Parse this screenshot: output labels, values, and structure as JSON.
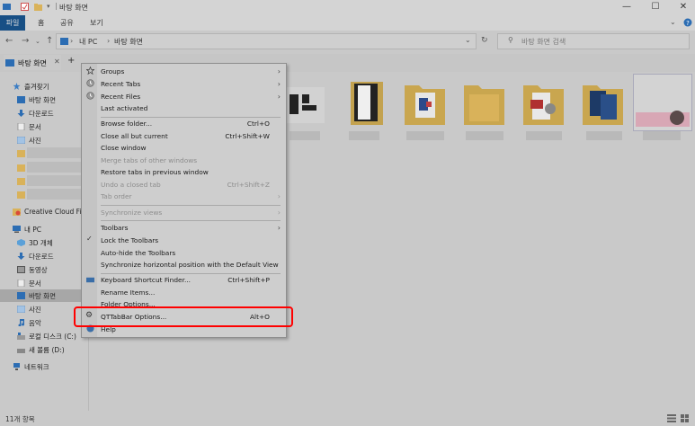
{
  "window": {
    "title": "바탕 화면",
    "controls": [
      "—",
      "☐",
      "✕"
    ]
  },
  "ribbon": {
    "tabs": [
      "파일",
      "홈",
      "공유",
      "보기"
    ]
  },
  "address": {
    "path": [
      "내 PC",
      "바탕 화면"
    ],
    "search_placeholder": "바탕 화면 검색"
  },
  "tabs": {
    "items": [
      {
        "label": "바탕 화면"
      }
    ],
    "add": "+"
  },
  "nav": {
    "quick_access": "즐겨찾기",
    "quick_items": [
      "바탕 화면",
      "다운로드",
      "문서",
      "사진"
    ],
    "creative_cloud": "Creative Cloud File",
    "this_pc": "내 PC",
    "pc_items": [
      "3D 개체",
      "다운로드",
      "동영상",
      "문서",
      "바탕 화면",
      "사진",
      "음악",
      "로컬 디스크 (C:)",
      "새 볼륨 (D:)"
    ],
    "network": "네트워크"
  },
  "status": {
    "count": "11개 항목"
  },
  "menu": {
    "items": [
      {
        "label": "Groups",
        "submenu": true,
        "icon": "star-icon"
      },
      {
        "label": "Recent Tabs",
        "submenu": true,
        "icon": "recent-tabs-icon"
      },
      {
        "label": "Recent Files",
        "submenu": true,
        "icon": "recent-files-icon"
      },
      {
        "label": "Last activated"
      },
      {
        "separator": true
      },
      {
        "label": "Browse folder...",
        "shortcut": "Ctrl+O"
      },
      {
        "label": "Close all but current",
        "shortcut": "Ctrl+Shift+W"
      },
      {
        "label": "Close window"
      },
      {
        "label": "Merge tabs of other windows",
        "disabled": true
      },
      {
        "label": "Restore tabs in previous window"
      },
      {
        "label": "Undo a closed tab",
        "shortcut": "Ctrl+Shift+Z",
        "disabled": true
      },
      {
        "label": "Tab order",
        "submenu": true,
        "disabled": true
      },
      {
        "separator": true
      },
      {
        "label": "Synchronize views",
        "submenu": true,
        "disabled": true
      },
      {
        "separator": true
      },
      {
        "label": "Toolbars",
        "submenu": true
      },
      {
        "label": "Lock the Toolbars",
        "checked": true
      },
      {
        "label": "Auto-hide the Toolbars"
      },
      {
        "label": "Synchronize horizontal position with the Default View"
      },
      {
        "separator": true
      },
      {
        "label": "Keyboard Shortcut Finder...",
        "shortcut": "Ctrl+Shift+P",
        "icon": "keyboard-icon"
      },
      {
        "label": "Rename Items..."
      },
      {
        "label": "Folder Options..."
      },
      {
        "label": "QTTabBar Options...",
        "shortcut": "Alt+O",
        "icon": "gear-icon",
        "highlighted": true
      },
      {
        "label": "Help",
        "icon": "help-icon"
      }
    ]
  },
  "colors": {
    "highlight": "#ff0000",
    "file_tab": "#174f85",
    "folder": "#d9b25a"
  }
}
